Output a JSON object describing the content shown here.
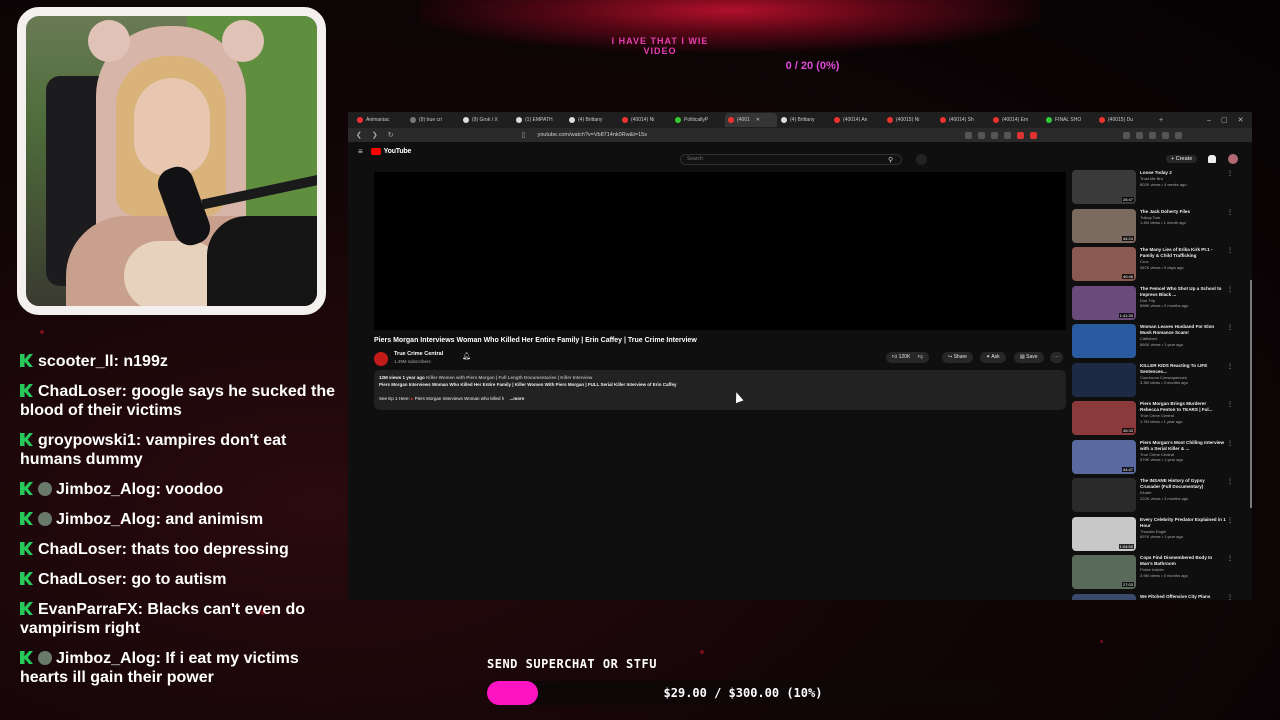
{
  "overlay": {
    "top_banner_text": "I HAVE THAT I WIE VIDEO",
    "vote_counter": "0 / 20 (0%)",
    "accent_color": "#ff14c4",
    "superchat_label": "SEND SUPERCHAT OR STFU",
    "goal_text": "$29.00 / $300.00 (10%)",
    "goal_progress": 0.1
  },
  "chat": {
    "messages": [
      {
        "user": "scooter_ll",
        "text": "n199z",
        "badge": "kick-icon",
        "emote": false
      },
      {
        "user": "ChadLoser",
        "text": "google says he sucked the blood of their victims",
        "badge": "kick-icon",
        "emote": false
      },
      {
        "user": "groypowski1",
        "text": "vampires don't eat humans dummy",
        "badge": "kick-icon",
        "emote": false
      },
      {
        "user": "Jimboz_Alog",
        "text": "voodoo",
        "badge": "kick-icon",
        "emote": true
      },
      {
        "user": "Jimboz_Alog",
        "text": "and animism",
        "badge": "kick-icon",
        "emote": true
      },
      {
        "user": "ChadLoser",
        "text": "thats too depressing",
        "badge": "kick-icon",
        "emote": false
      },
      {
        "user": "ChadLoser",
        "text": "go to autism",
        "badge": "kick-icon",
        "emote": false
      },
      {
        "user": "EvanParraFX",
        "text": "Blacks can't even do vampirism right",
        "badge": "kick-icon",
        "emote": false
      },
      {
        "user": "Jimboz_Alog",
        "text": "If i eat my victims hearts ill gain their power",
        "badge": "kick-icon",
        "emote": true
      }
    ]
  },
  "browser": {
    "tabs": [
      {
        "label": "Animaniac",
        "color": "#e33"
      },
      {
        "label": "(9) true cri",
        "color": "#777"
      },
      {
        "label": "(9) Grok / X",
        "color": "#ddd"
      },
      {
        "label": "(1) EMPATH",
        "color": "#ddd"
      },
      {
        "label": "(4) Brittany",
        "color": "#ddd"
      },
      {
        "label": "(40014) Ni",
        "color": "#e33"
      },
      {
        "label": "PoliticallyP",
        "color": "#3c3"
      },
      {
        "label": "(4001",
        "color": "#e33",
        "active": true
      },
      {
        "label": "(4) Brittany",
        "color": "#ddd"
      },
      {
        "label": "(40014) An",
        "color": "#e33"
      },
      {
        "label": "(40015) Ni",
        "color": "#e33"
      },
      {
        "label": "(40014) Sh",
        "color": "#e33"
      },
      {
        "label": "(40014) Em",
        "color": "#e33"
      },
      {
        "label": "FINAL SHO",
        "color": "#3c3"
      },
      {
        "label": "(40015) Du",
        "color": "#e33"
      }
    ],
    "url": "youtube.com/watch?v=Vb8714nk0Rw&t=15s"
  },
  "youtube": {
    "logo_text": "YouTube",
    "search_placeholder": "Search",
    "create_label": "+ Create",
    "video_title": "Piers Morgan Interviews Woman Who Killed Her Entire Family | Erin Caffey | True Crime Interview",
    "channel_name": "True Crime Central",
    "channel_subs": "1.49M subscribers",
    "like_count": "120K",
    "share_label": "Share",
    "ask_label": "Ask",
    "save_label": "Save",
    "description": {
      "meta_views": "12M views",
      "meta_age": "1 year ago",
      "meta_tags": "Killer Women with Piers Morgan | Full Length Documentaries | Killer Interview",
      "line2": "Piers Morgan Interviews Woman Who Killed Her Entire Family | Killer Women With Piers Morgan | FULL Serial Killer Interview of Erin Caffey",
      "line3_prefix": "See Ep 1 Here:",
      "line3_link": "Piers Morgan Interviews Woman who killed h",
      "more": "...more"
    },
    "recommendations": [
      {
        "title": "Loose Today 2",
        "channel": "Trust Me Bro",
        "meta": "802K views • 4 weeks ago",
        "duration": "26:47",
        "thumb": "#3a3a3a"
      },
      {
        "title": "The Jack Doherty Files",
        "channel": "Tulkay Tom",
        "meta": "1.4M views • 1 month ago",
        "duration": "44:24",
        "thumb": "#7a6a60"
      },
      {
        "title": "The Many Lies of Erika Kirk Pt.1 - Family & Child Trafficking",
        "channel": "Cruz",
        "meta": "387K views • 5 days ago",
        "duration": "40:46",
        "thumb": "#8a5a50"
      },
      {
        "title": "The Femcel Who Shot Up a School to Impress Black ...",
        "channel": "Doe Trip",
        "meta": "896K views • 2 months ago",
        "duration": "1:41:30",
        "thumb": "#6a4a7a"
      },
      {
        "title": "Woman Leaves Husband For Elon Musk Romance Scam!",
        "channel": "Catfished",
        "meta": "860K views • 1 year ago",
        "duration": "",
        "thumb": "#2a5aa0"
      },
      {
        "title": "KILLER KIDS Reacting To LIFE Sentences...",
        "channel": "Courtroom Consequences",
        "meta": "3.3M views • 3 months ago",
        "duration": "",
        "thumb": "#1e2a44"
      },
      {
        "title": "Piers Morgan Brings Murderer Rebecca Fenton to TEARS | Ful...",
        "channel": "True Crime Central",
        "meta": "1.7M views • 1 year ago",
        "duration": "45:33",
        "thumb": "#8a3a3a"
      },
      {
        "title": "Piers Morgan's Most Chilling Interview with a Serial Killer & ...",
        "channel": "True Crime Central",
        "meta": "979K views • 1 year ago",
        "duration": "44:47",
        "thumb": "#5a6aa0"
      },
      {
        "title": "The INSANE History of Gypsy Crusader (Full Documentary)",
        "channel": "Kluder",
        "meta": "222K views • 3 months ago",
        "duration": "",
        "thumb": "#2a2a2a"
      },
      {
        "title": "Every Celebrity Predator Explained in 1 Hour",
        "channel": "Thunder Eagle",
        "meta": "697K views • 1 year ago",
        "duration": "1:04:55",
        "thumb": "#c8c8c8"
      },
      {
        "title": "Cops Find Dismembered Body In Man's Bathroom",
        "channel": "Police Insider",
        "meta": "3.9M views • 5 months ago",
        "duration": "27:03",
        "thumb": "#5a6a5a"
      },
      {
        "title": "We Pitched Offensive City Plans",
        "channel": "",
        "meta": "",
        "duration": "",
        "thumb": "#3a4a6a"
      }
    ]
  }
}
